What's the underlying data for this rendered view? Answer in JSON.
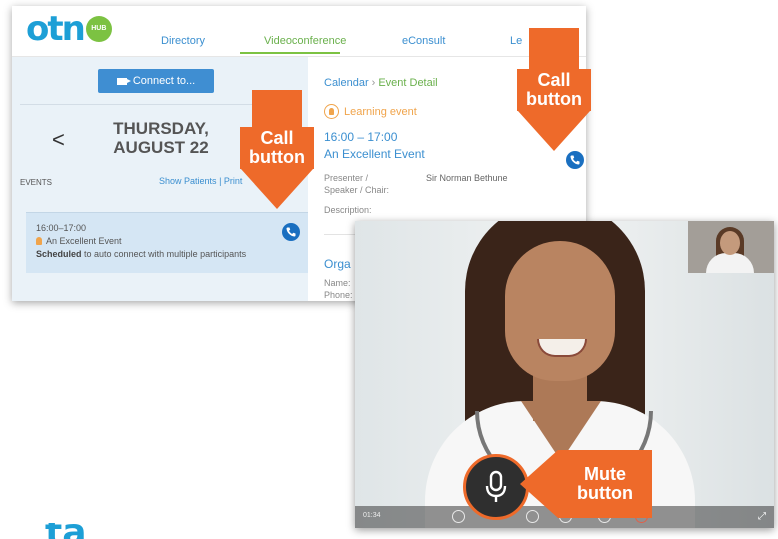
{
  "app": {
    "logo_text": "otn",
    "logo_badge": "HUB"
  },
  "nav": {
    "directory": "Directory",
    "videoconference": "Videoconference",
    "econsult": "eConsult",
    "truncated": "Le"
  },
  "left": {
    "connect_label": "Connect to...",
    "prev_symbol": "<",
    "day": "THURSDAY,",
    "date": "AUGUST 22",
    "events_label": "EVENTS",
    "show_patients": "Show Patients",
    "print": "| Print",
    "event": {
      "time": "16:00–17:00",
      "title": "An Excellent Event",
      "status": "Scheduled",
      "status_rest": "to auto connect with multiple participants"
    }
  },
  "right": {
    "crumb_calendar": "Calendar",
    "crumb_sep": "›",
    "crumb_detail": "Event Detail",
    "learning": "Learning event",
    "time": "16:00 – 17:00",
    "title": "An Excellent Event",
    "presenter_label_1": "Presenter /",
    "presenter_label_2": "Speaker / Chair:",
    "presenter_value": "Sir Norman Bethune",
    "description_label": "Description:",
    "org": "Orga",
    "name_label": "Name:",
    "phone_label": "Phone:"
  },
  "video": {
    "timer": "01:34"
  },
  "callouts": {
    "call_1": "Call button",
    "call_2": "Call button",
    "mute": "Mute button"
  },
  "partial_heading": "ta"
}
